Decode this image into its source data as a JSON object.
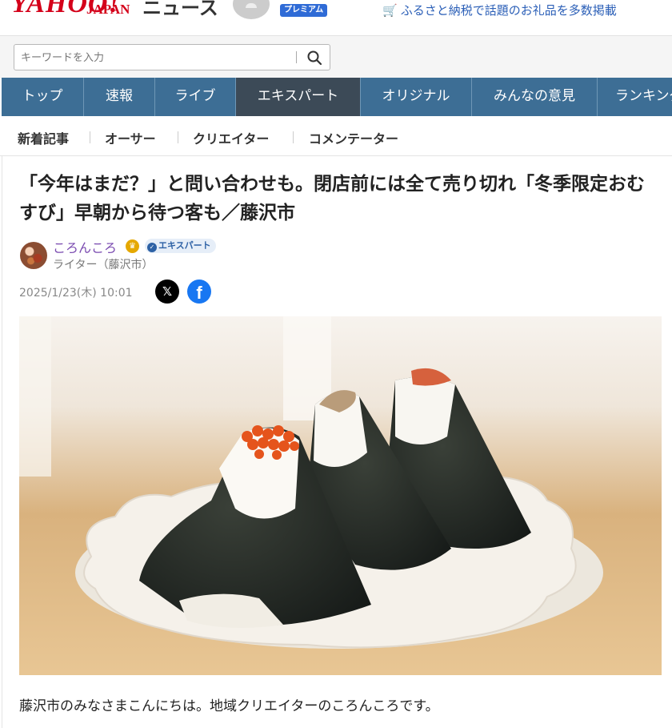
{
  "header": {
    "logo": "YAHOO!",
    "logo_sub": "JAPAN",
    "service": "ニュース",
    "premium": "プレミアム",
    "promo": "ふるさと納税で話題のお礼品を多数掲載",
    "colors": {
      "brand": "#d4001a",
      "link": "#2b5fb7"
    }
  },
  "search": {
    "placeholder": "キーワードを入力",
    "button_icon": "search-icon"
  },
  "nav": {
    "tabs": [
      "トップ",
      "速報",
      "ライブ",
      "エキスパート",
      "オリジナル",
      "みんなの意見",
      "ランキング"
    ],
    "active": "エキスパート"
  },
  "subnav": {
    "items": [
      "新着記事",
      "オーサー",
      "クリエイター",
      "コメンテーター"
    ]
  },
  "article": {
    "title": "「今年はまだ？」と問い合わせも。閉店前には全て売り切れ「冬季限定おむすび」早朝から待つ客も／藤沢市",
    "author": {
      "name": "ころんころ",
      "badge": "エキスパート",
      "role": "ライター（藤沢市）"
    },
    "date": "2025/1/23(木) 10:01",
    "share": {
      "x_icon": "x-logo-icon",
      "facebook_icon": "facebook-icon"
    },
    "lead": "藤沢市のみなさまこんにちは。地域クリエイターのころんころです。"
  }
}
